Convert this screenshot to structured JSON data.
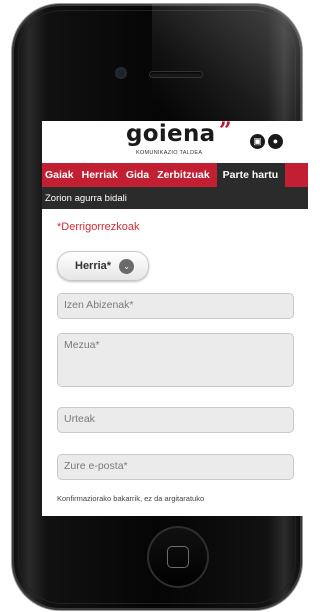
{
  "logo": {
    "brand": "goiena",
    "quote_mark": "”",
    "subtitle": "KOMUNIKAZIO TALDEA"
  },
  "header_icons": [
    {
      "name": "tv-icon",
      "glyph": "▣"
    },
    {
      "name": "microphone-icon",
      "glyph": "●"
    }
  ],
  "nav": {
    "items": [
      "Gaiak",
      "Herriak",
      "Gida",
      "Zerbitzuak"
    ],
    "active": "Parte hartu"
  },
  "subbar": {
    "title": "Zorion agurra bidali"
  },
  "form": {
    "required_note": "*Derrigorrezkoak",
    "herria_button": "Herria*",
    "chevron_glyph": "⌄",
    "name_placeholder": "Izen Abizenak*",
    "message_placeholder": "Mezua*",
    "age_placeholder": "Urteak",
    "email_placeholder": "Zure e-posta*",
    "email_note": "Konfirmaziorako bakarrik, ez da argitaratuko"
  },
  "colors": {
    "brand_red": "#c21f32",
    "dark_bar": "#2b2b2b",
    "required_red": "#d42a35"
  }
}
